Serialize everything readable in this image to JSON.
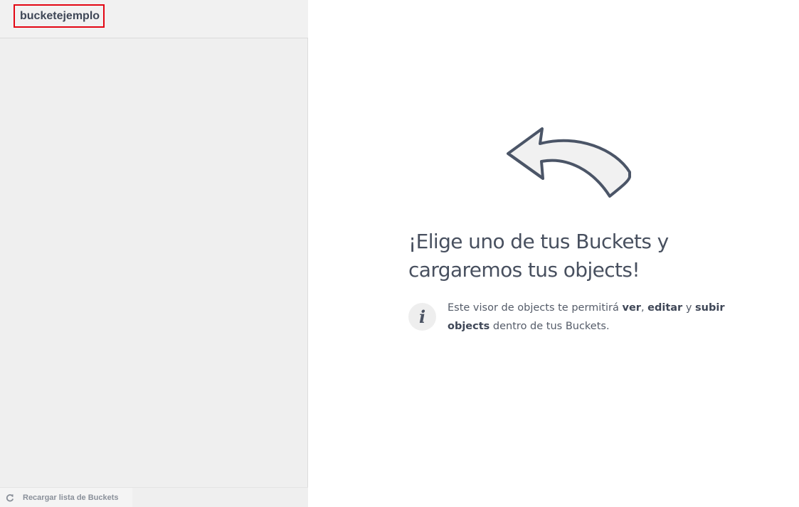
{
  "sidebar": {
    "buckets": [
      {
        "name": "bucketejemplo",
        "selected_highlight": "#e30613"
      }
    ],
    "reload_label": "Recargar lista de Buckets"
  },
  "main": {
    "heading": "¡Elige uno de tus Buckets y cargaremos tus objects!",
    "info_icon": "info-icon",
    "info": {
      "t1": "Este visor de objects te permitirá ",
      "b1": "ver",
      "t2": ", ",
      "b2": "editar",
      "t3": " y ",
      "b3": "subir objects",
      "t4": " dentro de tus Buckets."
    }
  },
  "colors": {
    "sidebar_bg": "#efefef",
    "text": "#48505f",
    "highlight": "#e30613"
  }
}
